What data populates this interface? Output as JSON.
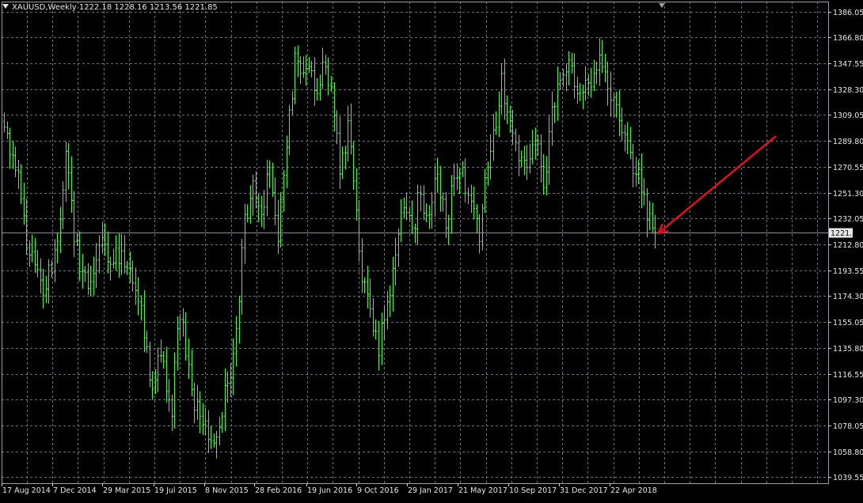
{
  "header": {
    "symbol": "XAUUSD,Weekly",
    "ohlc": "1222.18 1228.16 1213.56 1221.85"
  },
  "colors": {
    "background": "#000000",
    "grid": "#6a7078",
    "candle": "#33ff33",
    "axis_text": "#e8e8e8",
    "current_price_line": "#8a8f96",
    "arrow": "#e3111b"
  },
  "chart_data": {
    "type": "bar",
    "style": "candlestick-line",
    "title": "XAUUSD,Weekly",
    "ylim": [
      1035,
      1393
    ],
    "y_ticks": [
      1386.05,
      1366.8,
      1347.55,
      1328.3,
      1309.05,
      1289.8,
      1270.55,
      1251.3,
      1232.05,
      1212.8,
      1193.55,
      1174.3,
      1155.05,
      1135.8,
      1116.55,
      1097.3,
      1078.05,
      1058.8,
      1039.55
    ],
    "x_tick_labels": [
      "17 Aug 2014",
      "7 Dec 2014",
      "29 Mar 2015",
      "19 Jul 2015",
      "8 Nov 2015",
      "28 Feb 2016",
      "19 Jun 2016",
      "9 Oct 2016",
      "29 Jan 2017",
      "21 May 2017",
      "10 Sep 2017",
      "31 Dec 2017",
      "22 Apr 2018"
    ],
    "current_price": 1221.85,
    "grid": true,
    "waypoints": [
      {
        "w": 0,
        "c": 1300
      },
      {
        "w": 4,
        "c": 1268
      },
      {
        "w": 9,
        "c": 1205
      },
      {
        "w": 14,
        "c": 1175
      },
      {
        "w": 19,
        "c": 1215
      },
      {
        "w": 22,
        "c": 1282
      },
      {
        "w": 25,
        "c": 1215
      },
      {
        "w": 30,
        "c": 1180
      },
      {
        "w": 34,
        "c": 1212
      },
      {
        "w": 38,
        "c": 1198
      },
      {
        "w": 42,
        "c": 1208
      },
      {
        "w": 45,
        "c": 1195
      },
      {
        "w": 48,
        "c": 1170
      },
      {
        "w": 53,
        "c": 1105
      },
      {
        "w": 56,
        "c": 1130
      },
      {
        "w": 60,
        "c": 1085
      },
      {
        "w": 62,
        "c": 1150
      },
      {
        "w": 64,
        "c": 1155
      },
      {
        "w": 67,
        "c": 1105
      },
      {
        "w": 70,
        "c": 1085
      },
      {
        "w": 75,
        "c": 1065
      },
      {
        "w": 78,
        "c": 1085
      },
      {
        "w": 83,
        "c": 1150
      },
      {
        "w": 86,
        "c": 1235
      },
      {
        "w": 89,
        "c": 1260
      },
      {
        "w": 92,
        "c": 1235
      },
      {
        "w": 95,
        "c": 1270
      },
      {
        "w": 98,
        "c": 1215
      },
      {
        "w": 101,
        "c": 1285
      },
      {
        "w": 104,
        "c": 1355
      },
      {
        "w": 106,
        "c": 1340
      },
      {
        "w": 109,
        "c": 1345
      },
      {
        "w": 112,
        "c": 1325
      },
      {
        "w": 115,
        "c": 1345
      },
      {
        "w": 117,
        "c": 1330
      },
      {
        "w": 120,
        "c": 1265
      },
      {
        "w": 123,
        "c": 1305
      },
      {
        "w": 125,
        "c": 1260
      },
      {
        "w": 128,
        "c": 1185
      },
      {
        "w": 131,
        "c": 1165
      },
      {
        "w": 134,
        "c": 1130
      },
      {
        "w": 137,
        "c": 1170
      },
      {
        "w": 140,
        "c": 1205
      },
      {
        "w": 143,
        "c": 1240
      },
      {
        "w": 146,
        "c": 1225
      },
      {
        "w": 149,
        "c": 1250
      },
      {
        "w": 152,
        "c": 1235
      },
      {
        "w": 155,
        "c": 1265
      },
      {
        "w": 158,
        "c": 1225
      },
      {
        "w": 161,
        "c": 1262
      },
      {
        "w": 164,
        "c": 1270
      },
      {
        "w": 167,
        "c": 1245
      },
      {
        "w": 170,
        "c": 1215
      },
      {
        "w": 173,
        "c": 1270
      },
      {
        "w": 176,
        "c": 1300
      },
      {
        "w": 178,
        "c": 1340
      },
      {
        "w": 181,
        "c": 1305
      },
      {
        "w": 184,
        "c": 1275
      },
      {
        "w": 187,
        "c": 1270
      },
      {
        "w": 190,
        "c": 1290
      },
      {
        "w": 193,
        "c": 1255
      },
      {
        "w": 196,
        "c": 1315
      },
      {
        "w": 199,
        "c": 1335
      },
      {
        "w": 202,
        "c": 1350
      },
      {
        "w": 205,
        "c": 1325
      },
      {
        "w": 208,
        "c": 1335
      },
      {
        "w": 211,
        "c": 1340
      },
      {
        "w": 214,
        "c": 1345
      },
      {
        "w": 217,
        "c": 1320
      },
      {
        "w": 220,
        "c": 1305
      },
      {
        "w": 223,
        "c": 1290
      },
      {
        "w": 226,
        "c": 1265
      },
      {
        "w": 229,
        "c": 1250
      },
      {
        "w": 232,
        "c": 1225
      },
      {
        "w": 233,
        "c": 1221.85
      }
    ]
  },
  "annotation": {
    "type": "arrow",
    "color": "#e3111b",
    "from": {
      "w": 276,
      "price": 1293
    },
    "to": {
      "w": 233,
      "price": 1221
    }
  }
}
